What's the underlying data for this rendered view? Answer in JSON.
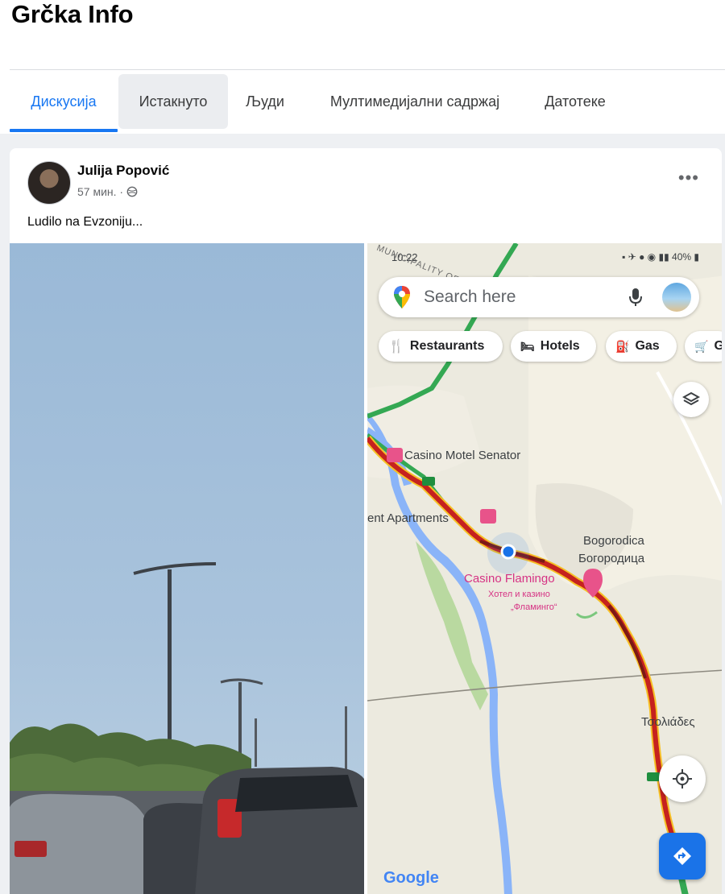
{
  "group": {
    "title": "Grčka Info"
  },
  "tabs": [
    {
      "label": "Дискусија"
    },
    {
      "label": "Истакнуто"
    },
    {
      "label": "Људи"
    },
    {
      "label": "Мултимедијални садржај"
    },
    {
      "label": "Датотеке"
    }
  ],
  "post": {
    "author": "Julija Popović",
    "time": "57 мин. ·",
    "text": "Ludilo na Evzoniju..."
  },
  "map": {
    "status_time": "10:22",
    "status_right": "40%",
    "search_placeholder": "Search here",
    "chips": [
      "Restaurants",
      "Hotels",
      "Gas",
      "G"
    ],
    "places": {
      "casino_motel": "Casino Motel Senator",
      "apartments": "ent Apartments",
      "bogorodica_lat": "Bogorodica",
      "bogorodica_cyr": "Богородица",
      "casino_flamingo": "Casino Flamingo",
      "flamingo_cyr_1": "Хотел и казино",
      "flamingo_cyr_2": "„Фламинго“",
      "tsoliades": "Τσολιάδες",
      "municipality": "MUNICIPALITY OF"
    },
    "google": "Google",
    "colors": {
      "traffic_red": "#c5221f",
      "traffic_dark": "#7a1a14",
      "traffic_green": "#34a853",
      "river": "#8ab4f8"
    }
  }
}
